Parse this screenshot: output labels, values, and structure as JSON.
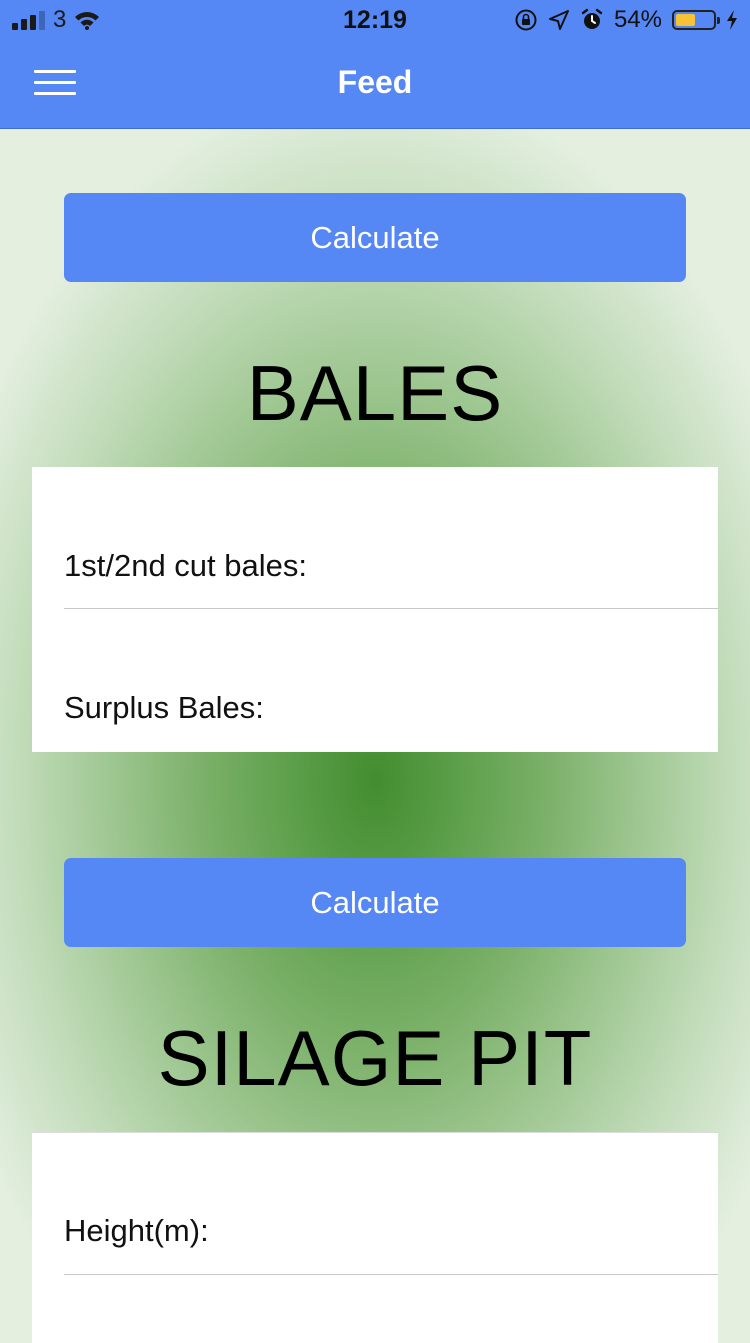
{
  "status_bar": {
    "carrier": "3",
    "time": "12:19",
    "battery_percent": "54%",
    "battery_level": 0.54,
    "icons": [
      "signal-icon",
      "wifi-icon",
      "orientation-lock-icon",
      "location-icon",
      "alarm-icon",
      "battery-icon",
      "charging-icon"
    ]
  },
  "nav": {
    "title": "Feed",
    "menu_icon": "hamburger-menu-icon"
  },
  "colors": {
    "primary": "#5587f5",
    "background_center": "#438d2f",
    "background_edge": "#e4efe0",
    "battery_fill": "#f7c236"
  },
  "bales": {
    "calculate_label": "Calculate",
    "title": "BALES",
    "fields": [
      {
        "label": "1st/2nd cut bales:"
      },
      {
        "label": "Surplus Bales:"
      }
    ]
  },
  "silage_pit": {
    "calculate_label": "Calculate",
    "title": "SILAGE PIT",
    "fields": [
      {
        "label": "Height(m):"
      }
    ]
  }
}
